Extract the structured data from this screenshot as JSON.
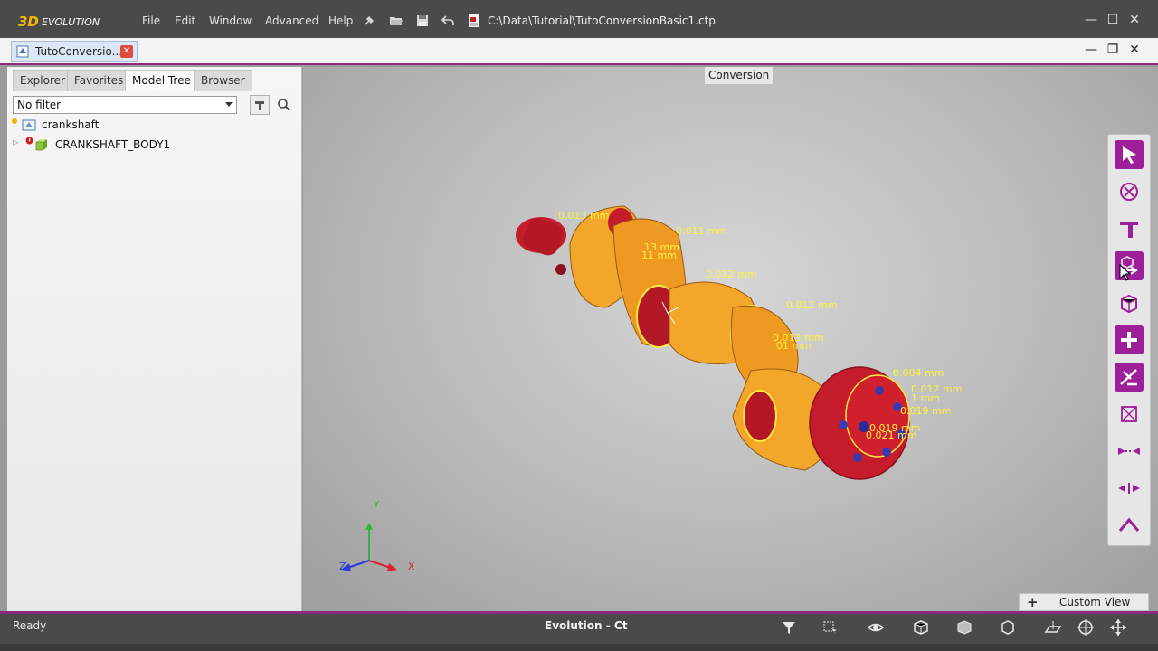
{
  "app": {
    "logo_text": "3D EVOLUTION",
    "menu": [
      "File",
      "Edit",
      "Window",
      "Advanced",
      "Help"
    ],
    "file_path": "C:\\Data\\Tutorial\\TutoConversionBasic1.ctp"
  },
  "document": {
    "tab_label": "TutoConversio..."
  },
  "left_panel": {
    "tabs": [
      "Explorer",
      "Favorites",
      "Model Tree",
      "Browser"
    ],
    "active_tab": "Model Tree",
    "filter_value": "No filter",
    "tree": [
      {
        "label": "crankshaft"
      },
      {
        "label": "CRANKSHAFT_BODY1"
      }
    ]
  },
  "viewport": {
    "tab_label": "Conversion",
    "axis_labels": {
      "x": "X",
      "y": "Y",
      "z": "Z"
    },
    "annotations": [
      "0.013 mm",
      "0.011 mm",
      "13 mm",
      "11 mm",
      "0.012 mm",
      "0.012 mm",
      "0.013 mm",
      "01 mm",
      "0.004 mm",
      "0.012 mm",
      "1 mm",
      "0.019 mm",
      "0.019 mm",
      "0.021 mm"
    ],
    "colors": {
      "body": "#f2a62a",
      "journal": "#b8152a",
      "annotation": "#ffee33",
      "accent": "#9d1f9a"
    }
  },
  "right_toolbar": {
    "tools": [
      "pointer-icon",
      "cancel-icon",
      "filter-icon",
      "convert-icon",
      "body-icon",
      "add-icon",
      "repair-icon",
      "box-icon",
      "shrink-icon",
      "expand-icon",
      "up-icon"
    ]
  },
  "custom_view": {
    "label": "Custom View"
  },
  "status_bar": {
    "status": "Ready",
    "title": "Evolution - Ct"
  }
}
